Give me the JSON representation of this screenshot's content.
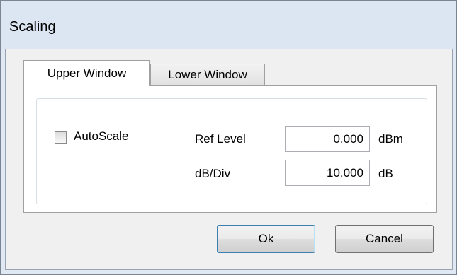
{
  "window": {
    "title": "Scaling"
  },
  "tabs": [
    {
      "label": "Upper Window",
      "active": true
    },
    {
      "label": "Lower Window",
      "active": false
    }
  ],
  "autoscale": {
    "label": "AutoScale",
    "checked": false
  },
  "ref_level": {
    "label": "Ref Level",
    "value": "0.000",
    "unit": "dBm"
  },
  "db_div": {
    "label": "dB/Div",
    "value": "10.000",
    "unit": "dB"
  },
  "buttons": {
    "ok_label": "Ok",
    "cancel_label": "Cancel"
  }
}
